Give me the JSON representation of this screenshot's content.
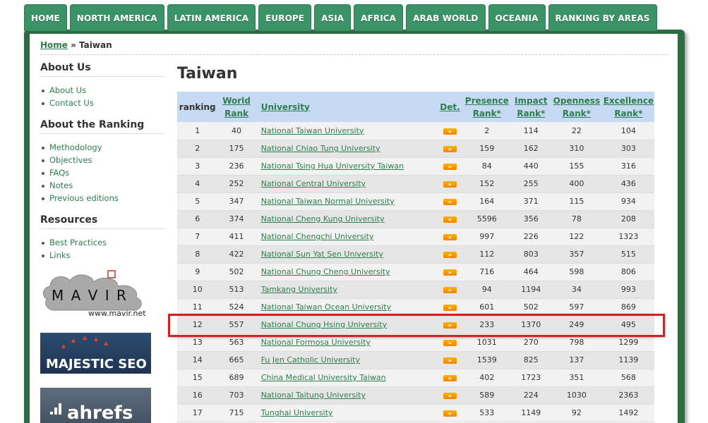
{
  "nav": [
    "HOME",
    "NORTH AMERICA",
    "LATIN AMERICA",
    "EUROPE",
    "ASIA",
    "AFRICA",
    "ARAB WORLD",
    "OCEANIA",
    "RANKING BY AREAS"
  ],
  "breadcrumb": {
    "home": "Home",
    "sep": " » ",
    "current": "Taiwan"
  },
  "sidebar": {
    "about_title": "About Us",
    "about_items": [
      "About Us",
      "Contact Us"
    ],
    "ranking_title": "About the Ranking",
    "ranking_items": [
      "Methodology",
      "Objectives",
      "FAQs",
      "Notes",
      "Previous editions"
    ],
    "resources_title": "Resources",
    "resources_items": [
      "Best Practices",
      "Links"
    ],
    "logos": {
      "mavir": "www.mavir.net",
      "majestic": "MAJESTIC SEO",
      "ahrefs": "ahrefs"
    }
  },
  "page_title": "Taiwan",
  "table": {
    "headers": {
      "ranking": "ranking",
      "world_rank": [
        "World",
        "Rank"
      ],
      "university": "University",
      "det": "Det.",
      "presence": [
        "Presence",
        "Rank*"
      ],
      "impact": [
        "Impact",
        "Rank*"
      ],
      "openness": [
        "Openness",
        "Rank*"
      ],
      "excellence": [
        "Excellence",
        "Rank*"
      ]
    },
    "det_label": "»",
    "rows": [
      [
        "1",
        "40",
        "National Taiwan University",
        "2",
        "114",
        "22",
        "104"
      ],
      [
        "2",
        "175",
        "National Chiao Tung University",
        "159",
        "162",
        "310",
        "303"
      ],
      [
        "3",
        "236",
        "National Tsing Hua University Taiwan",
        "84",
        "440",
        "155",
        "316"
      ],
      [
        "4",
        "252",
        "National Central University",
        "152",
        "255",
        "400",
        "436"
      ],
      [
        "5",
        "347",
        "National Taiwan Normal University",
        "164",
        "371",
        "115",
        "934"
      ],
      [
        "6",
        "374",
        "National Cheng Kung University",
        "5596",
        "356",
        "78",
        "208"
      ],
      [
        "7",
        "411",
        "National Chengchi University",
        "997",
        "226",
        "122",
        "1323"
      ],
      [
        "8",
        "422",
        "National Sun Yat Sen University",
        "112",
        "803",
        "357",
        "515"
      ],
      [
        "9",
        "502",
        "National Chung Cheng University",
        "716",
        "464",
        "598",
        "806"
      ],
      [
        "10",
        "513",
        "Tamkang University",
        "94",
        "1194",
        "34",
        "993"
      ],
      [
        "11",
        "524",
        "National Taiwan Ocean University",
        "601",
        "502",
        "597",
        "869"
      ],
      [
        "12",
        "557",
        "National Chung Hsing University",
        "233",
        "1370",
        "249",
        "495"
      ],
      [
        "13",
        "563",
        "National Formosa University",
        "1031",
        "270",
        "798",
        "1299"
      ],
      [
        "14",
        "665",
        "Fu Jen Catholic University",
        "1539",
        "825",
        "137",
        "1139"
      ],
      [
        "15",
        "689",
        "China Medical University Taiwan",
        "402",
        "1723",
        "351",
        "568"
      ],
      [
        "16",
        "703",
        "National Taitung University",
        "589",
        "224",
        "1030",
        "2363"
      ],
      [
        "17",
        "715",
        "Tunghai University",
        "533",
        "1149",
        "92",
        "1492"
      ]
    ]
  },
  "colors": {
    "nav_green": "#3a9364",
    "frame_green": "#2d6b45",
    "link_green": "#2e7d4f",
    "header_blue": "#c6daf4",
    "highlight_red": "#d42020"
  }
}
